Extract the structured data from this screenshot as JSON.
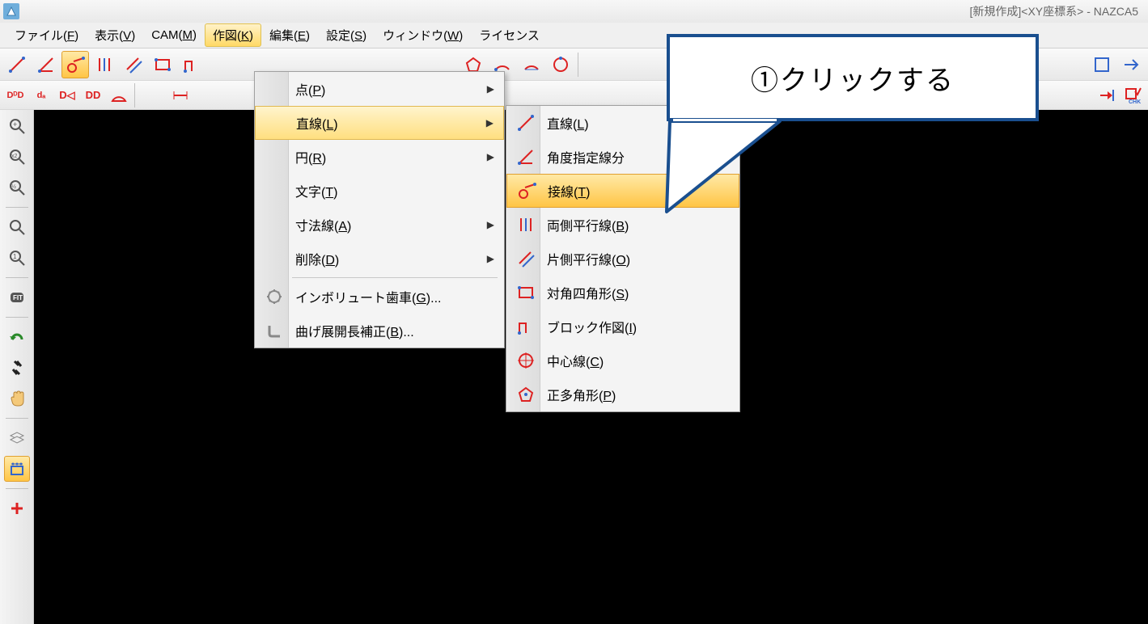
{
  "title": {
    "doc": "[新規作成]",
    "coord": "<XY座標系>",
    "sep": " - ",
    "app": "NAZCA5"
  },
  "menubar": {
    "file": "ファイル(<u>F</u>)",
    "view": "表示(<u>V</u>)",
    "cam": "CAM(<u>M</u>)",
    "draw": "作図(<u>K</u>)",
    "edit": "編集(<u>E</u>)",
    "settings": "設定(<u>S</u>)",
    "window": "ウィンドウ(<u>W</u>)",
    "license": "ライセンス"
  },
  "draw_menu": {
    "point": "点(<u>P</u>)",
    "line": "直線(<u>L</u>)",
    "circle": "円(<u>R</u>)",
    "text": "文字(<u>T</u>)",
    "dim": "寸法線(<u>A</u>)",
    "delete": "削除(<u>D</u>)",
    "involute": "インボリュート歯車(<u>G</u>)...",
    "bend": "曲げ展開長補正(<u>B</u>)..."
  },
  "line_submenu": {
    "line": "直線(<u>L</u>)",
    "angle": "角度指定線分",
    "tangent": "接線(<u>T</u>)",
    "parallel_both": "両側平行線(<u>B</u>)",
    "parallel_one": "片側平行線(<u>O</u>)",
    "rect": "対角四角形(<u>S</u>)",
    "block": "ブロック作図(<u>I</u>)",
    "center": "中心線(<u>C</u>)",
    "polygon": "正多角形(<u>P</u>)"
  },
  "callout": {
    "text": "①クリックする"
  }
}
